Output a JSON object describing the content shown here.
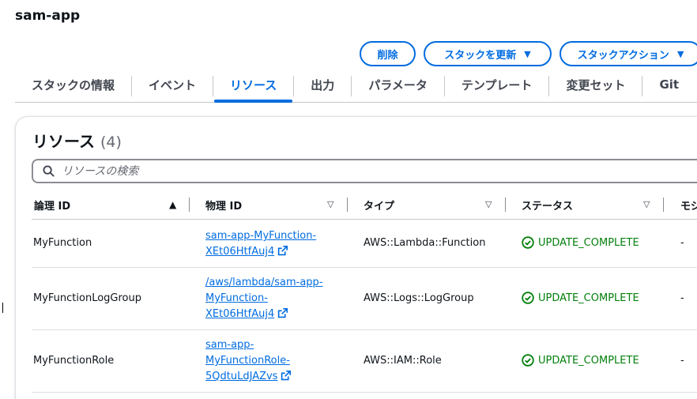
{
  "page": {
    "title": "sam-app"
  },
  "actions": {
    "delete": "削除",
    "update": "スタックを更新",
    "stack_actions": "スタックアクション"
  },
  "tabs": [
    {
      "label": "スタックの情報"
    },
    {
      "label": "イベント"
    },
    {
      "label": "リソース"
    },
    {
      "label": "出力"
    },
    {
      "label": "パラメータ"
    },
    {
      "label": "テンプレート"
    },
    {
      "label": "変更セット"
    },
    {
      "label": "Git"
    }
  ],
  "panel": {
    "title": "リソース",
    "count": "(4)",
    "search_placeholder": "リソースの検索"
  },
  "table": {
    "headers": [
      "論理 ID",
      "物理 ID",
      "タイプ",
      "ステータス",
      "モジ"
    ],
    "rows": [
      {
        "logical_id": "MyFunction",
        "physical_lines": [
          "sam-app-MyFunction-",
          "XEt06HtfAuj4"
        ],
        "type": "AWS::Lambda::Function",
        "status": "UPDATE_COMPLETE",
        "module": "-"
      },
      {
        "logical_id": "MyFunctionLogGroup",
        "physical_lines": [
          "/aws/lambda/sam-app-",
          "MyFunction-",
          "XEt06HtfAuj4"
        ],
        "type": "AWS::Logs::LogGroup",
        "status": "UPDATE_COMPLETE",
        "module": "-"
      },
      {
        "logical_id": "MyFunctionRole",
        "physical_lines": [
          "sam-app-",
          "MyFunctionRole-",
          "5QdtuLdJAZvs"
        ],
        "type": "AWS::IAM::Role",
        "status": "UPDATE_COMPLETE",
        "module": "-"
      }
    ]
  },
  "colors": {
    "accent": "#006ce0",
    "success": "#037f0c",
    "text": "#0f141a"
  }
}
